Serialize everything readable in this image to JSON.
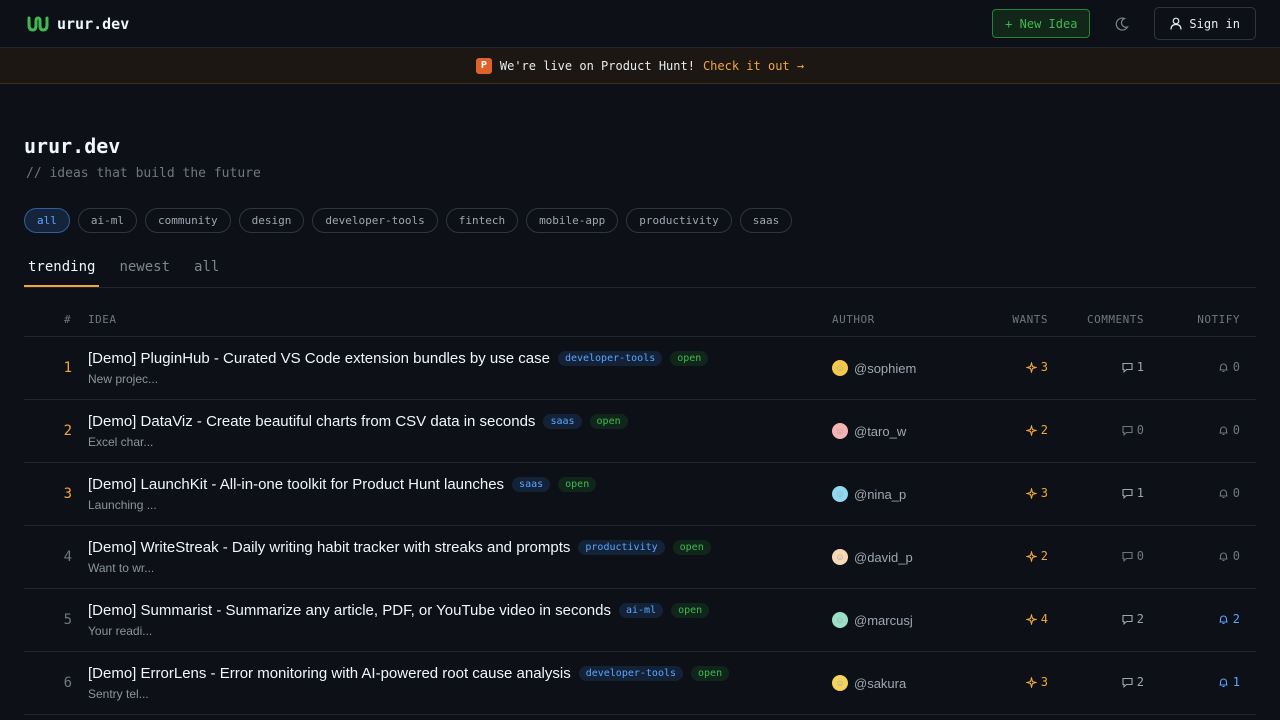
{
  "header": {
    "brand": "urur.dev",
    "new_idea_label": "+ New Idea",
    "sign_in_label": "Sign in"
  },
  "banner": {
    "text": "We're live on Product Hunt!",
    "link": "Check it out →",
    "icon_letter": "P"
  },
  "hero": {
    "title": "urur.dev",
    "tagline": "// ideas that build the future"
  },
  "tags": [
    "all",
    "ai-ml",
    "community",
    "design",
    "developer-tools",
    "fintech",
    "mobile-app",
    "productivity",
    "saas"
  ],
  "active_tag": "all",
  "tabs": [
    "trending",
    "newest",
    "all"
  ],
  "active_tab": "trending",
  "table": {
    "headers": {
      "rank": "#",
      "idea": "IDEA",
      "author": "AUTHOR",
      "wants": "WANTS",
      "comments": "COMMENTS",
      "notify": "NOTIFY"
    },
    "rows": [
      {
        "rank": "1",
        "title": "[Demo] PluginHub - Curated VS Code extension bundles by use case",
        "category": "developer-tools",
        "status": "open",
        "desc": "New projec...",
        "author": "@sophiem",
        "avatar_color": "#f5c84c",
        "avatar_glyph": "☺",
        "wants": "3",
        "comments": "1",
        "notify": "0"
      },
      {
        "rank": "2",
        "title": "[Demo] DataViz - Create beautiful charts from CSV data in seconds",
        "category": "saas",
        "status": "open",
        "desc": "Excel char...",
        "author": "@taro_w",
        "avatar_color": "#f5b3b3",
        "avatar_glyph": "☺",
        "wants": "2",
        "comments": "0",
        "notify": "0"
      },
      {
        "rank": "3",
        "title": "[Demo] LaunchKit - All-in-one toolkit for Product Hunt launches",
        "category": "saas",
        "status": "open",
        "desc": "Launching ...",
        "author": "@nina_p",
        "avatar_color": "#8fd8f0",
        "avatar_glyph": "☺",
        "wants": "3",
        "comments": "1",
        "notify": "0"
      },
      {
        "rank": "4",
        "title": "[Demo] WriteStreak - Daily writing habit tracker with streaks and prompts",
        "category": "productivity",
        "status": "open",
        "desc": "Want to wr...",
        "author": "@david_p",
        "avatar_color": "#f7d9b5",
        "avatar_glyph": "☺",
        "wants": "2",
        "comments": "0",
        "notify": "0"
      },
      {
        "rank": "5",
        "title": "[Demo] Summarist - Summarize any article, PDF, or YouTube video in seconds",
        "category": "ai-ml",
        "status": "open",
        "desc": "Your readi...",
        "author": "@marcusj",
        "avatar_color": "#9be0c6",
        "avatar_glyph": "☺",
        "wants": "4",
        "comments": "2",
        "notify": "2"
      },
      {
        "rank": "6",
        "title": "[Demo] ErrorLens - Error monitoring with AI-powered root cause analysis",
        "category": "developer-tools",
        "status": "open",
        "desc": "Sentry tel...",
        "author": "@sakura",
        "avatar_color": "#f5d45c",
        "avatar_glyph": "☺",
        "wants": "3",
        "comments": "2",
        "notify": "1"
      }
    ]
  }
}
